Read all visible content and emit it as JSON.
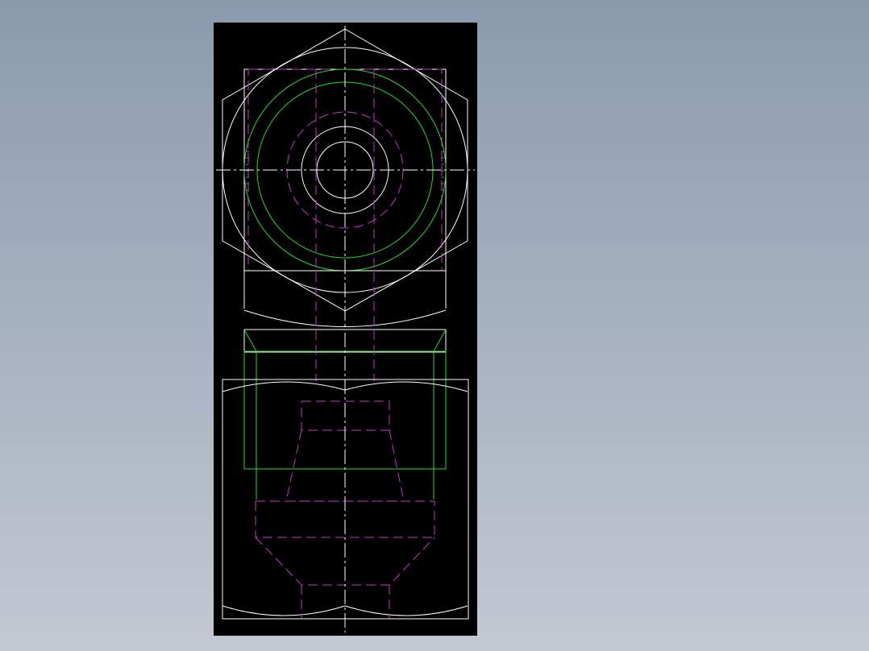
{
  "drawing": {
    "background_color": "#000000",
    "line_colors": {
      "visible": "#ffffff",
      "thread": "#22dd22",
      "hidden": "#cc33cc",
      "center": "#ffffff"
    },
    "views": [
      "top-view-hex-fitting",
      "side-view-hex-fitting"
    ]
  }
}
